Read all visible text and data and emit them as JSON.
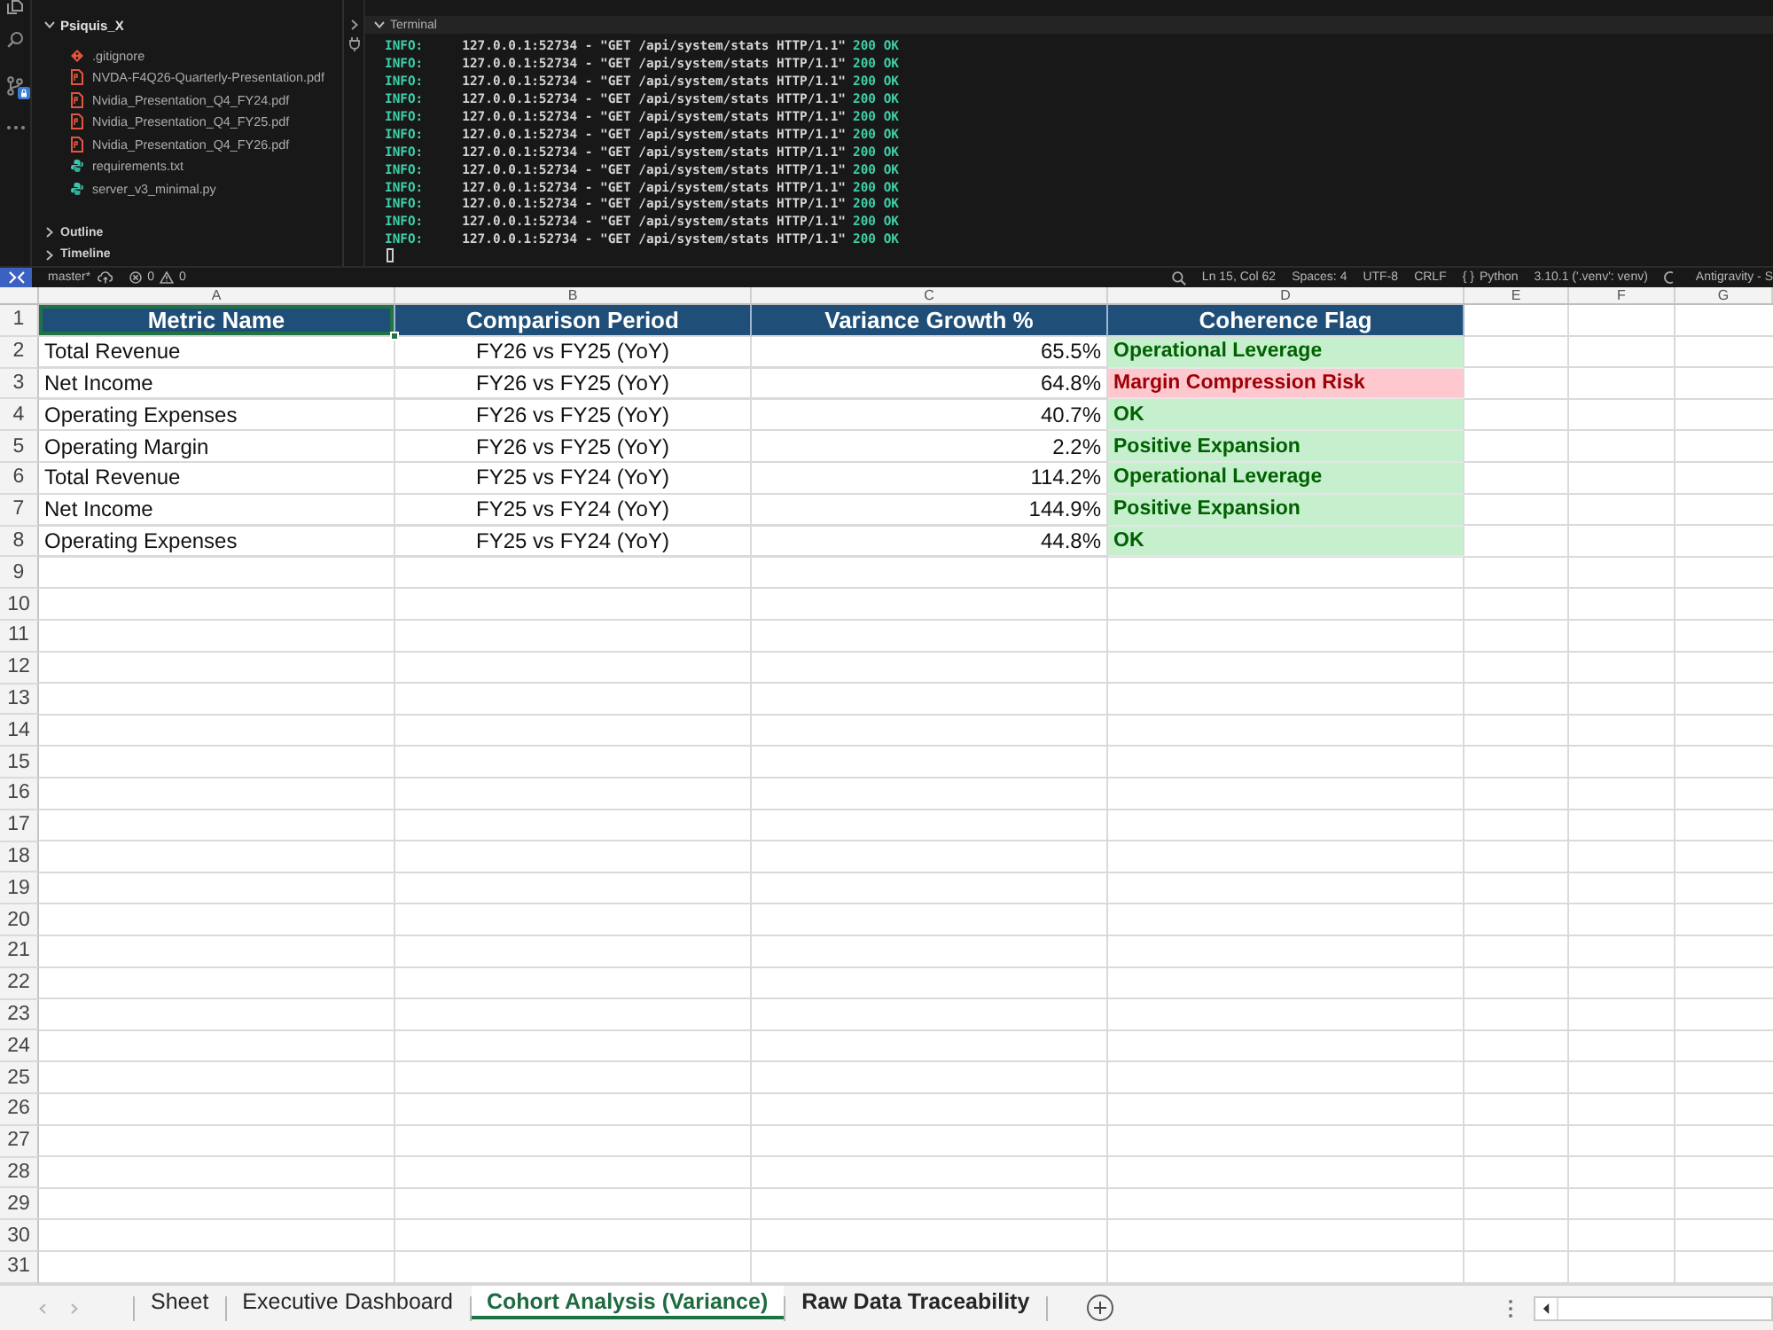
{
  "explorer": {
    "folder": {
      "name": "Psiquis_X",
      "expanded": true,
      "children": [
        {
          "name": ".gitignore",
          "kind": "git"
        },
        {
          "name": "NVDA-F4Q26-Quarterly-Presentation.pdf",
          "kind": "pdf"
        },
        {
          "name": "Nvidia_Presentation_Q4_FY24.pdf",
          "kind": "pdf"
        },
        {
          "name": "Nvidia_Presentation_Q4_FY25.pdf",
          "kind": "pdf"
        },
        {
          "name": "Nvidia_Presentation_Q4_FY26.pdf",
          "kind": "pdf"
        },
        {
          "name": "requirements.txt",
          "kind": "python"
        },
        {
          "name": "server_v3_minimal.py",
          "kind": "python"
        }
      ]
    },
    "sections": [
      {
        "label": "Outline",
        "expanded": false
      },
      {
        "label": "Timeline",
        "expanded": false
      }
    ]
  },
  "terminal": {
    "title": "Terminal",
    "expanded": true,
    "lines": [
      {
        "tag": "INFO:",
        "request": "127.0.0.1:52734 - \"GET /api/system/stats HTTP/1.1\"",
        "status": "200 OK"
      },
      {
        "tag": "INFO:",
        "request": "127.0.0.1:52734 - \"GET /api/system/stats HTTP/1.1\"",
        "status": "200 OK"
      },
      {
        "tag": "INFO:",
        "request": "127.0.0.1:52734 - \"GET /api/system/stats HTTP/1.1\"",
        "status": "200 OK"
      },
      {
        "tag": "INFO:",
        "request": "127.0.0.1:52734 - \"GET /api/system/stats HTTP/1.1\"",
        "status": "200 OK"
      },
      {
        "tag": "INFO:",
        "request": "127.0.0.1:52734 - \"GET /api/system/stats HTTP/1.1\"",
        "status": "200 OK"
      },
      {
        "tag": "INFO:",
        "request": "127.0.0.1:52734 - \"GET /api/system/stats HTTP/1.1\"",
        "status": "200 OK"
      },
      {
        "tag": "INFO:",
        "request": "127.0.0.1:52734 - \"GET /api/system/stats HTTP/1.1\"",
        "status": "200 OK"
      },
      {
        "tag": "INFO:",
        "request": "127.0.0.1:52734 - \"GET /api/system/stats HTTP/1.1\"",
        "status": "200 OK"
      },
      {
        "tag": "INFO:",
        "request": "127.0.0.1:52734 - \"GET /api/system/stats HTTP/1.1\"",
        "status": "200 OK"
      },
      {
        "tag": "INFO:",
        "request": "127.0.0.1:52734 - \"GET /api/system/stats HTTP/1.1\"",
        "status": "200 OK"
      },
      {
        "tag": "INFO:",
        "request": "127.0.0.1:52734 - \"GET /api/system/stats HTTP/1.1\"",
        "status": "200 OK"
      },
      {
        "tag": "INFO:",
        "request": "127.0.0.1:52734 - \"GET /api/system/stats HTTP/1.1\"",
        "status": "200 OK"
      }
    ]
  },
  "status_bar": {
    "branch": "master*",
    "errors": "0",
    "warnings": "0",
    "items": [
      "Ln 15, Col 62",
      "Spaces: 4",
      "UTF-8",
      "CRLF"
    ],
    "language_glyph": "{ }",
    "language": "Python",
    "interpreter": "3.10.1 ('.venv': venv)",
    "account": "Antigravity - S"
  },
  "sheet": {
    "columns": [
      "A",
      "B",
      "C",
      "D",
      "E",
      "F",
      "G"
    ],
    "row_numbers": [
      "1",
      "2",
      "3",
      "4",
      "5",
      "6",
      "7",
      "8",
      "9",
      "10",
      "11",
      "12",
      "13",
      "14",
      "15",
      "16",
      "17",
      "18",
      "19",
      "20",
      "21",
      "22",
      "23",
      "24",
      "25",
      "26",
      "27",
      "28",
      "29",
      "30",
      "31"
    ],
    "header": [
      {
        "text": "Metric Name",
        "selected": true
      },
      {
        "text": "Comparison Period",
        "selected": false
      },
      {
        "text": "Variance Growth %",
        "selected": false
      },
      {
        "text": "Coherence Flag",
        "selected": false
      }
    ],
    "rows": [
      {
        "metric": "Total Revenue",
        "period": "FY26 vs FY25 (YoY)",
        "variance": "65.5%",
        "flag": "Operational Leverage",
        "color": "#c6efce"
      },
      {
        "metric": "Net Income",
        "period": "FY26 vs FY25 (YoY)",
        "variance": "64.8%",
        "flag": "Margin Compression Risk",
        "color": "#ffc7ce"
      },
      {
        "metric": "Operating Expenses",
        "period": "FY26 vs FY25 (YoY)",
        "variance": "40.7%",
        "flag": "OK",
        "color": "#c6efce"
      },
      {
        "metric": "Operating Margin",
        "period": "FY26 vs FY25 (YoY)",
        "variance": "2.2%",
        "flag": "Positive Expansion",
        "color": "#c6efce"
      },
      {
        "metric": "Total Revenue",
        "period": "FY25 vs FY24 (YoY)",
        "variance": "114.2%",
        "flag": "Operational Leverage",
        "color": "#c6efce"
      },
      {
        "metric": "Net Income",
        "period": "FY25 vs FY24 (YoY)",
        "variance": "144.9%",
        "flag": "Positive Expansion",
        "color": "#c6efce"
      },
      {
        "metric": "Operating Expenses",
        "period": "FY25 vs FY24 (YoY)",
        "variance": "44.8%",
        "flag": "OK",
        "color": "#c6efce"
      }
    ]
  },
  "sheet_tabs": [
    {
      "label": "Sheet",
      "selected": false,
      "hovered": false
    },
    {
      "label": "Executive Dashboard",
      "selected": false,
      "hovered": false
    },
    {
      "label": "Cohort Analysis (Variance)",
      "selected": true,
      "hovered": false
    },
    {
      "label": "Raw Data Traceability",
      "selected": false,
      "hovered": true
    }
  ]
}
